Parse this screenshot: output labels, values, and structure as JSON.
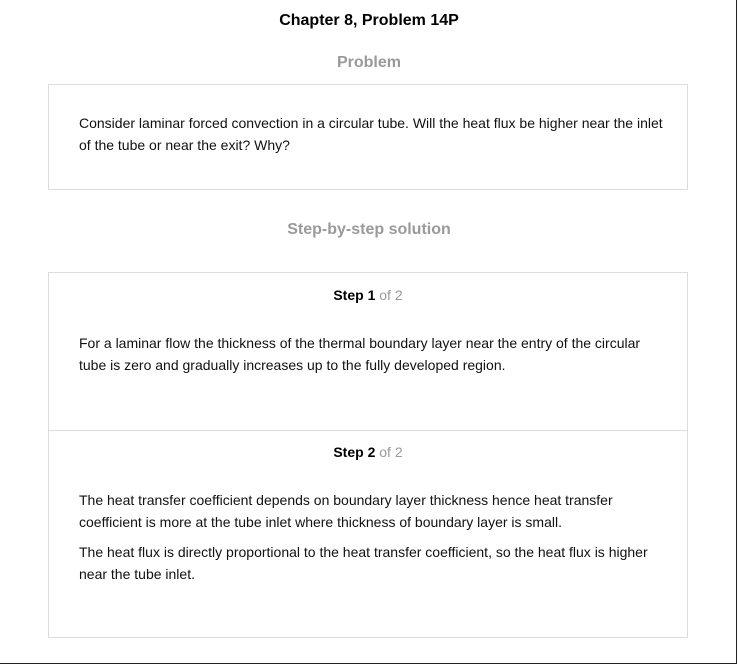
{
  "document": {
    "title": "Chapter 8, Problem 14P"
  },
  "problem": {
    "heading": "Problem",
    "text": "Consider laminar forced convection in a circular tube. Will the heat flux be higher near the inlet of the tube or near the exit? Why?"
  },
  "solution": {
    "heading": "Step-by-step solution",
    "step_word": "Step",
    "of_word": "of",
    "total_steps": "2",
    "steps": [
      {
        "number": "1",
        "paragraphs": [
          "For a laminar flow the thickness of the thermal boundary layer near the entry of the circular tube is zero and gradually increases up to the fully developed region."
        ]
      },
      {
        "number": "2",
        "paragraphs": [
          "The heat transfer coefficient depends on boundary layer thickness hence heat transfer coefficient is more at the tube inlet where thickness of boundary layer is small.",
          "The heat flux is directly proportional to the heat transfer coefficient, so the heat flux is higher near the tube inlet."
        ]
      }
    ]
  }
}
